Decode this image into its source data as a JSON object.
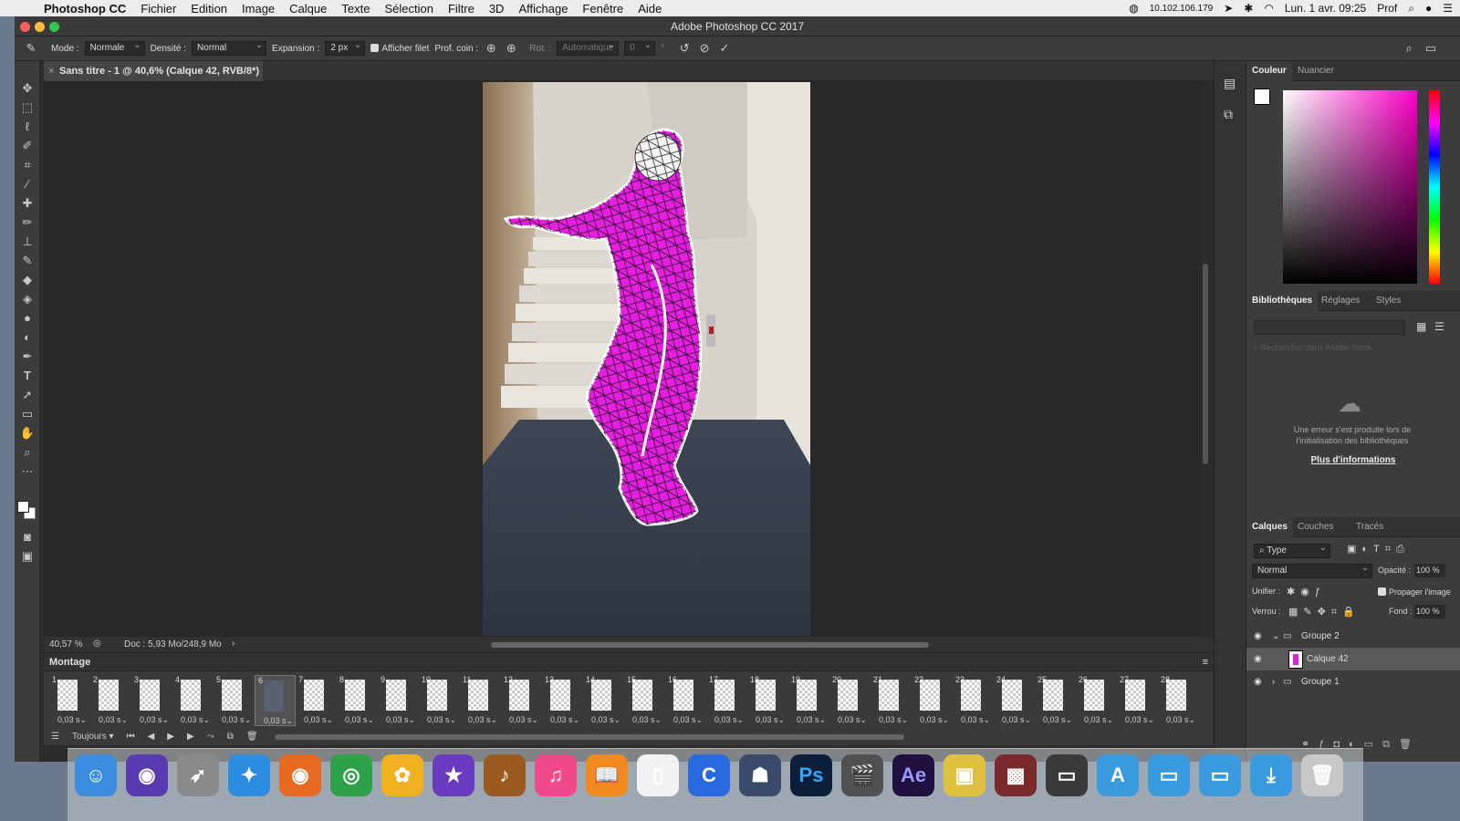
{
  "menubar": {
    "app": "Photoshop CC",
    "items": [
      "Fichier",
      "Edition",
      "Image",
      "Calque",
      "Texte",
      "Sélection",
      "Filtre",
      "3D",
      "Affichage",
      "Fenêtre",
      "Aide"
    ],
    "ip": "10.102.106.179",
    "datetime": "Lun. 1 avr. 09:25",
    "user": "Prof"
  },
  "window": {
    "title": "Adobe Photoshop CC 2017"
  },
  "options": {
    "mode_label": "Mode :",
    "mode_value": "Normale",
    "density_label": "Densité :",
    "density_value": "Normal",
    "expansion_label": "Expansion :",
    "expansion_value": "2 px",
    "show_mesh": "Afficher filet",
    "pin_depth_label": "Prof. coin :",
    "rot_label": "Rot. :",
    "rot_value": "Automatique",
    "rot_angle": "0",
    "degree": "°"
  },
  "document": {
    "tab_title": "Sans titre - 1 @ 40,6% (Calque 42, RVB/8*) *",
    "zoom": "40,57 %",
    "doc_info": "Doc : 5,93 Mo/248,9 Mo"
  },
  "montage": {
    "title": "Montage",
    "loop": "Toujours",
    "frames": [
      {
        "n": "1",
        "d": "0,03 s"
      },
      {
        "n": "2",
        "d": "0,03 s"
      },
      {
        "n": "3",
        "d": "0,03 s"
      },
      {
        "n": "4",
        "d": "0,03 s"
      },
      {
        "n": "5",
        "d": "0,03 s"
      },
      {
        "n": "6",
        "d": "0,03 s"
      },
      {
        "n": "7",
        "d": "0,03 s"
      },
      {
        "n": "8",
        "d": "0,03 s"
      },
      {
        "n": "9",
        "d": "0,03 s"
      },
      {
        "n": "10",
        "d": "0,03 s"
      },
      {
        "n": "11",
        "d": "0,03 s"
      },
      {
        "n": "12",
        "d": "0,03 s"
      },
      {
        "n": "13",
        "d": "0,03 s"
      },
      {
        "n": "14",
        "d": "0,03 s"
      },
      {
        "n": "15",
        "d": "0,03 s"
      },
      {
        "n": "16",
        "d": "0,03 s"
      },
      {
        "n": "17",
        "d": "0,03 s"
      },
      {
        "n": "18",
        "d": "0,03 s"
      },
      {
        "n": "19",
        "d": "0,03 s"
      },
      {
        "n": "20",
        "d": "0,03 s"
      },
      {
        "n": "21",
        "d": "0,03 s"
      },
      {
        "n": "22",
        "d": "0,03 s"
      },
      {
        "n": "23",
        "d": "0,03 s"
      },
      {
        "n": "24",
        "d": "0,03 s"
      },
      {
        "n": "25",
        "d": "0,03 s"
      },
      {
        "n": "26",
        "d": "0,03 s"
      },
      {
        "n": "27",
        "d": "0,03 s"
      },
      {
        "n": "28",
        "d": "0,03 s"
      }
    ],
    "selected_frame": "6"
  },
  "color_panel": {
    "tabs": [
      "Couleur",
      "Nuancier"
    ]
  },
  "libraries": {
    "tabs": [
      "Bibliothèques",
      "Réglages",
      "Styles"
    ],
    "search_placeholder": "Rechercher dans Adobe Stock",
    "error": "Une erreur s'est produite lors de l'initialisation des bibliothèques",
    "link": "Plus d'informations"
  },
  "layers": {
    "tabs": [
      "Calques",
      "Couches",
      "Tracés"
    ],
    "filter": "Type",
    "blend": "Normal",
    "opacity_label": "Opacité :",
    "opacity": "100 %",
    "unify_label": "Unifier :",
    "propagate": "Propager l'image",
    "lock_label": "Verrou :",
    "fill_label": "Fond :",
    "fill": "100 %",
    "items": [
      "Groupe 2",
      "Calque 42",
      "Groupe 1"
    ]
  },
  "colors": {
    "accent_magenta": "#e51ee0",
    "panel": "#3c3c3c",
    "canvas_bg": "#282828"
  },
  "dock": {
    "apps": [
      "Finder",
      "Siri",
      "Launchpad",
      "Safari",
      "Firefox",
      "Chrome",
      "Photos",
      "iMovie",
      "GarageBand",
      "iTunes",
      "iBooks",
      "TextEdit",
      "Comic Life",
      "Stop Motion",
      "Photoshop",
      "Final Cut Pro",
      "After Effects",
      "Preview",
      "Photo Booth",
      "Documents",
      "Applications",
      "Dossier",
      "Documents",
      "Téléchargements",
      "Corbeille"
    ]
  }
}
